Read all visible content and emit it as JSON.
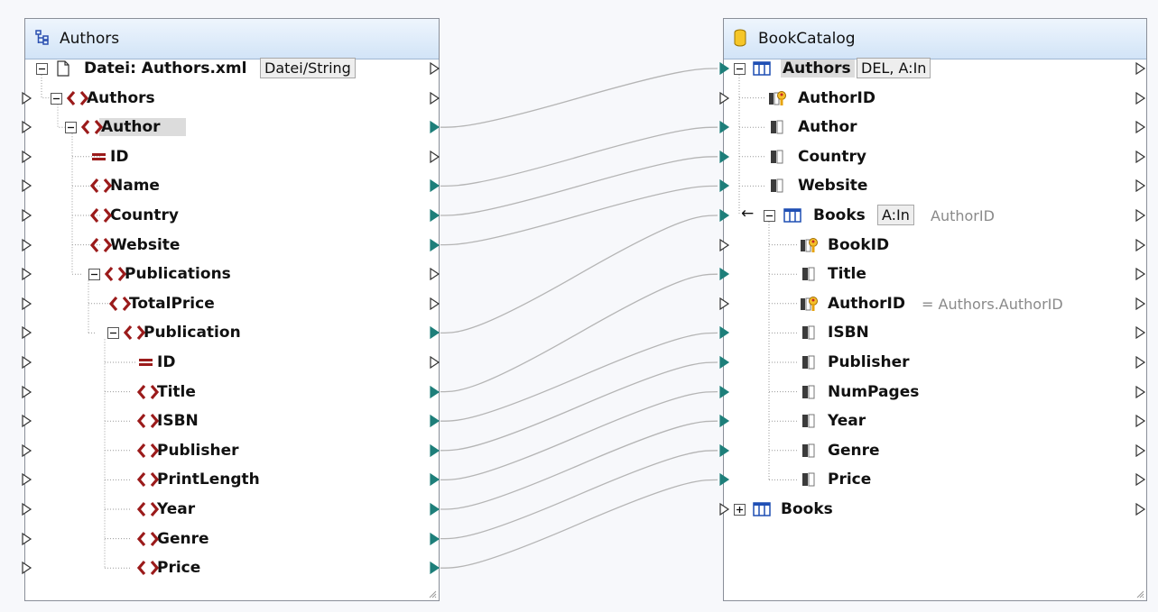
{
  "source": {
    "title": "Authors",
    "file_label": "Datei: Authors.xml",
    "file_button": "Datei/String",
    "nodes": [
      {
        "label": "Authors",
        "kind": "element"
      },
      {
        "label": "Author",
        "kind": "element"
      },
      {
        "label": "ID",
        "kind": "attribute"
      },
      {
        "label": "Name",
        "kind": "element"
      },
      {
        "label": "Country",
        "kind": "element"
      },
      {
        "label": "Website",
        "kind": "element"
      },
      {
        "label": "Publications",
        "kind": "element"
      },
      {
        "label": "TotalPrice",
        "kind": "element"
      },
      {
        "label": "Publication",
        "kind": "element"
      },
      {
        "label": "ID",
        "kind": "attribute"
      },
      {
        "label": "Title",
        "kind": "element"
      },
      {
        "label": "ISBN",
        "kind": "element"
      },
      {
        "label": "Publisher",
        "kind": "element"
      },
      {
        "label": "PrintLength",
        "kind": "element"
      },
      {
        "label": "Year",
        "kind": "element"
      },
      {
        "label": "Genre",
        "kind": "element"
      },
      {
        "label": "Price",
        "kind": "element"
      }
    ]
  },
  "target": {
    "title": "BookCatalog",
    "authors_table": {
      "label": "Authors",
      "tag": "DEL, A:In"
    },
    "authors_fields": [
      {
        "label": "AuthorID",
        "key": true
      },
      {
        "label": "Author",
        "key": false
      },
      {
        "label": "Country",
        "key": false
      },
      {
        "label": "Website",
        "key": false
      }
    ],
    "books_child": {
      "label": "Books",
      "tag": "A:In",
      "note": "AuthorID"
    },
    "books_fields": [
      {
        "label": "BookID",
        "key": true,
        "note": ""
      },
      {
        "label": "Title",
        "key": false,
        "note": ""
      },
      {
        "label": "AuthorID",
        "key": true,
        "note": "= Authors.AuthorID"
      },
      {
        "label": "ISBN",
        "key": false,
        "note": ""
      },
      {
        "label": "Publisher",
        "key": false,
        "note": ""
      },
      {
        "label": "NumPages",
        "key": false,
        "note": ""
      },
      {
        "label": "Year",
        "key": false,
        "note": ""
      },
      {
        "label": "Genre",
        "key": false,
        "note": ""
      },
      {
        "label": "Price",
        "key": false,
        "note": ""
      }
    ],
    "books_table": {
      "label": "Books"
    }
  },
  "connections": [
    {
      "from": "Author",
      "to": "Authors"
    },
    {
      "from": "Name",
      "to": "Author"
    },
    {
      "from": "Country",
      "to": "Country"
    },
    {
      "from": "Website",
      "to": "Website"
    },
    {
      "from": "Publication",
      "to": "Books"
    },
    {
      "from": "Title",
      "to": "Title"
    },
    {
      "from": "ISBN",
      "to": "ISBN"
    },
    {
      "from": "Publisher",
      "to": "Publisher"
    },
    {
      "from": "PrintLength",
      "to": "NumPages"
    },
    {
      "from": "Year",
      "to": "Year"
    },
    {
      "from": "Genre",
      "to": "Genre"
    },
    {
      "from": "Price",
      "to": "Price"
    }
  ],
  "colors": {
    "element_icon": "#9b1b1b",
    "connector_active": "#1e7f7a",
    "connection_line": "#b5b5b5"
  }
}
